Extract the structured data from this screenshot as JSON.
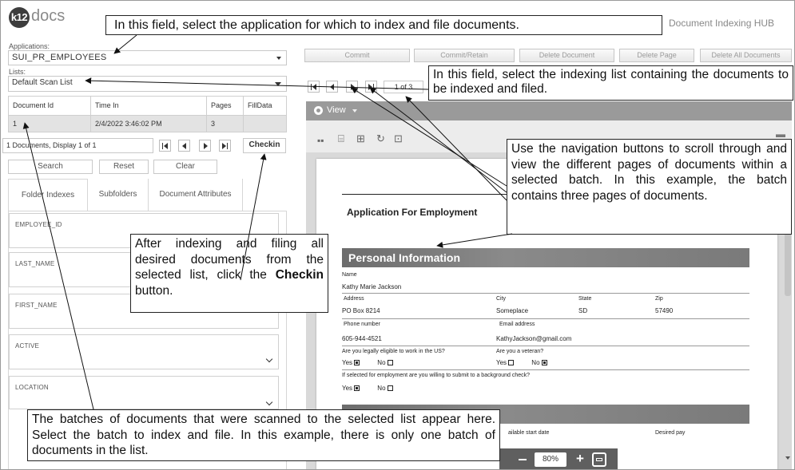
{
  "header": {
    "logo_mark": "k12",
    "logo_text": "docs",
    "hub_title": "Document Indexing HUB"
  },
  "applications": {
    "label": "Applications:",
    "value": "SUI_PR_EMPLOYEES"
  },
  "lists": {
    "label": "Lists:",
    "value": "Default Scan List"
  },
  "toolbar": {
    "commit": "Commit",
    "commit_retain": "Commit/Retain",
    "delete_document": "Delete Document",
    "delete_page": "Delete Page",
    "delete_all": "Delete All Documents"
  },
  "batch_table": {
    "columns": [
      "Document Id",
      "Time In",
      "Pages",
      "FillData"
    ],
    "rows": [
      {
        "id": "1",
        "time_in": "2/4/2022 3:46:02 PM",
        "pages": "3",
        "filldata": ""
      }
    ]
  },
  "batch_footer": {
    "display_text": "1 Documents, Display 1 of 1",
    "checkin": "Checkin"
  },
  "actions": {
    "search": "Search",
    "reset": "Reset",
    "clear": "Clear"
  },
  "tabs": {
    "folder_indexes": "Folder Indexes",
    "subfolders": "Subfolders",
    "document_attributes": "Document Attributes"
  },
  "fields": [
    "EMPLOYEE_ID",
    "LAST_NAME",
    "FIRST_NAME",
    "ACTIVE",
    "LOCATION"
  ],
  "viewer": {
    "page_indicator": "1 of 3",
    "view_label": "View",
    "zoom": "80%"
  },
  "document": {
    "title": "Application For Employment",
    "section1": "Personal Information",
    "name_label": "Name",
    "name_value": "Kathy Marie Jackson",
    "address_label": "Address",
    "address_value": "PO Box 8214",
    "city_label": "City",
    "city_value": "Someplace",
    "state_label": "State",
    "state_value": "SD",
    "zip_label": "Zip",
    "zip_value": "57490",
    "phone_label": "Phone number",
    "phone_value": "605-944-4521",
    "email_label": "Email address",
    "email_value": "KathyJackson@gmail.com",
    "eligible_q": "Are you legally eligible to work in the US?",
    "veteran_q": "Are you a veteran?",
    "yes": "Yes",
    "no": "No",
    "background_q": "If selected for employment are you willing to submit to a background check?",
    "start_date_label": "ailable start date",
    "desired_pay_label": "Desired pay"
  },
  "callouts": {
    "applications": "In this field, select the application for which to index and file documents.",
    "lists": "In this field, select the indexing list containing the documents to be indexed and filed.",
    "navigation": "Use the navigation buttons to scroll through and view the different pages of documents within a selected batch. In this example, the batch contains three pages of documents.",
    "checkin_pre": "After indexing and filing all desired documents from the selected list, click the",
    "checkin_bold": "Checkin",
    "checkin_post": "button.",
    "batches": "The batches of documents that were scanned to the selected list appear here. Select the batch to index and file. In this example, there is only one batch of documents in the list."
  }
}
